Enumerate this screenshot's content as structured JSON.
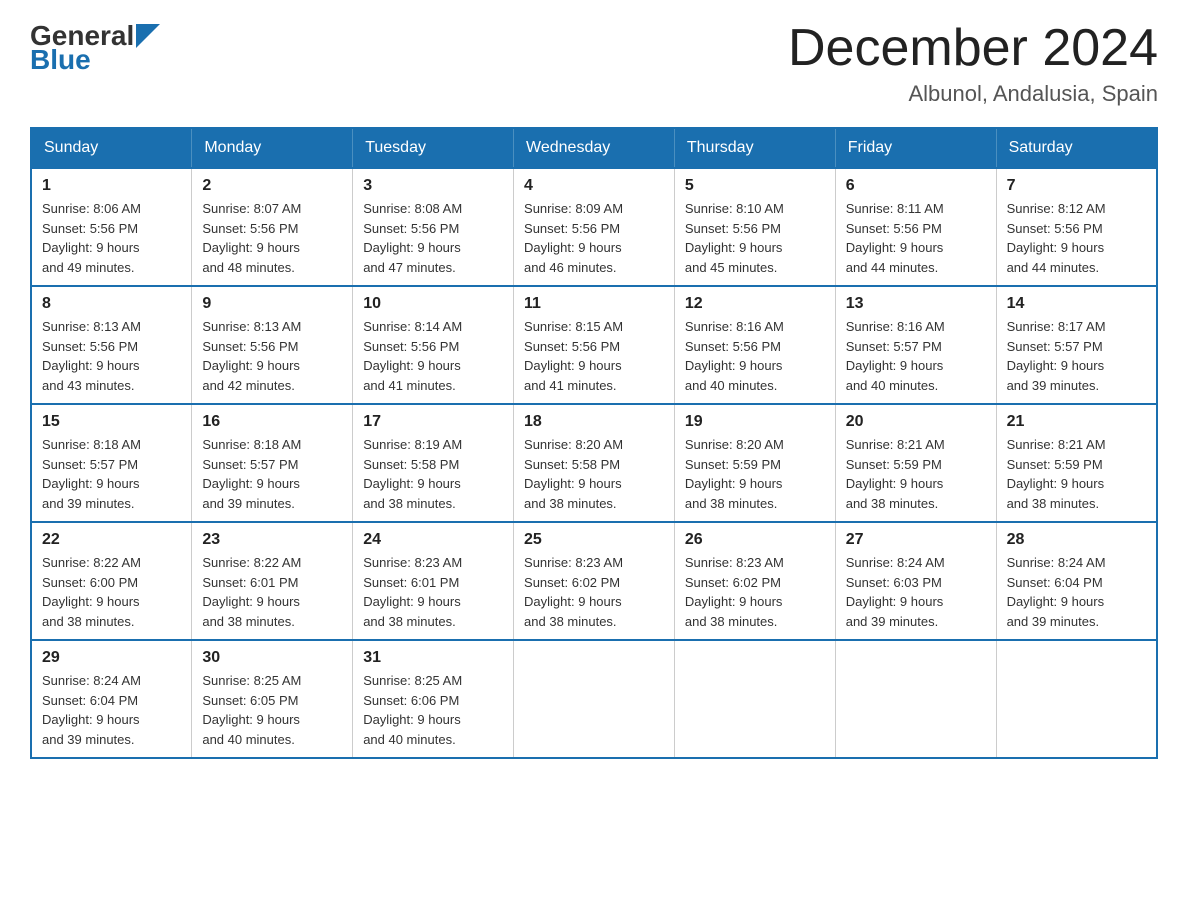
{
  "header": {
    "logo_general": "General",
    "logo_blue": "Blue",
    "month_year": "December 2024",
    "location": "Albunol, Andalusia, Spain"
  },
  "weekdays": [
    "Sunday",
    "Monday",
    "Tuesday",
    "Wednesday",
    "Thursday",
    "Friday",
    "Saturday"
  ],
  "weeks": [
    [
      {
        "day": "1",
        "sunrise": "8:06 AM",
        "sunset": "5:56 PM",
        "daylight": "9 hours and 49 minutes."
      },
      {
        "day": "2",
        "sunrise": "8:07 AM",
        "sunset": "5:56 PM",
        "daylight": "9 hours and 48 minutes."
      },
      {
        "day": "3",
        "sunrise": "8:08 AM",
        "sunset": "5:56 PM",
        "daylight": "9 hours and 47 minutes."
      },
      {
        "day": "4",
        "sunrise": "8:09 AM",
        "sunset": "5:56 PM",
        "daylight": "9 hours and 46 minutes."
      },
      {
        "day": "5",
        "sunrise": "8:10 AM",
        "sunset": "5:56 PM",
        "daylight": "9 hours and 45 minutes."
      },
      {
        "day": "6",
        "sunrise": "8:11 AM",
        "sunset": "5:56 PM",
        "daylight": "9 hours and 44 minutes."
      },
      {
        "day": "7",
        "sunrise": "8:12 AM",
        "sunset": "5:56 PM",
        "daylight": "9 hours and 44 minutes."
      }
    ],
    [
      {
        "day": "8",
        "sunrise": "8:13 AM",
        "sunset": "5:56 PM",
        "daylight": "9 hours and 43 minutes."
      },
      {
        "day": "9",
        "sunrise": "8:13 AM",
        "sunset": "5:56 PM",
        "daylight": "9 hours and 42 minutes."
      },
      {
        "day": "10",
        "sunrise": "8:14 AM",
        "sunset": "5:56 PM",
        "daylight": "9 hours and 41 minutes."
      },
      {
        "day": "11",
        "sunrise": "8:15 AM",
        "sunset": "5:56 PM",
        "daylight": "9 hours and 41 minutes."
      },
      {
        "day": "12",
        "sunrise": "8:16 AM",
        "sunset": "5:56 PM",
        "daylight": "9 hours and 40 minutes."
      },
      {
        "day": "13",
        "sunrise": "8:16 AM",
        "sunset": "5:57 PM",
        "daylight": "9 hours and 40 minutes."
      },
      {
        "day": "14",
        "sunrise": "8:17 AM",
        "sunset": "5:57 PM",
        "daylight": "9 hours and 39 minutes."
      }
    ],
    [
      {
        "day": "15",
        "sunrise": "8:18 AM",
        "sunset": "5:57 PM",
        "daylight": "9 hours and 39 minutes."
      },
      {
        "day": "16",
        "sunrise": "8:18 AM",
        "sunset": "5:57 PM",
        "daylight": "9 hours and 39 minutes."
      },
      {
        "day": "17",
        "sunrise": "8:19 AM",
        "sunset": "5:58 PM",
        "daylight": "9 hours and 38 minutes."
      },
      {
        "day": "18",
        "sunrise": "8:20 AM",
        "sunset": "5:58 PM",
        "daylight": "9 hours and 38 minutes."
      },
      {
        "day": "19",
        "sunrise": "8:20 AM",
        "sunset": "5:59 PM",
        "daylight": "9 hours and 38 minutes."
      },
      {
        "day": "20",
        "sunrise": "8:21 AM",
        "sunset": "5:59 PM",
        "daylight": "9 hours and 38 minutes."
      },
      {
        "day": "21",
        "sunrise": "8:21 AM",
        "sunset": "5:59 PM",
        "daylight": "9 hours and 38 minutes."
      }
    ],
    [
      {
        "day": "22",
        "sunrise": "8:22 AM",
        "sunset": "6:00 PM",
        "daylight": "9 hours and 38 minutes."
      },
      {
        "day": "23",
        "sunrise": "8:22 AM",
        "sunset": "6:01 PM",
        "daylight": "9 hours and 38 minutes."
      },
      {
        "day": "24",
        "sunrise": "8:23 AM",
        "sunset": "6:01 PM",
        "daylight": "9 hours and 38 minutes."
      },
      {
        "day": "25",
        "sunrise": "8:23 AM",
        "sunset": "6:02 PM",
        "daylight": "9 hours and 38 minutes."
      },
      {
        "day": "26",
        "sunrise": "8:23 AM",
        "sunset": "6:02 PM",
        "daylight": "9 hours and 38 minutes."
      },
      {
        "day": "27",
        "sunrise": "8:24 AM",
        "sunset": "6:03 PM",
        "daylight": "9 hours and 39 minutes."
      },
      {
        "day": "28",
        "sunrise": "8:24 AM",
        "sunset": "6:04 PM",
        "daylight": "9 hours and 39 minutes."
      }
    ],
    [
      {
        "day": "29",
        "sunrise": "8:24 AM",
        "sunset": "6:04 PM",
        "daylight": "9 hours and 39 minutes."
      },
      {
        "day": "30",
        "sunrise": "8:25 AM",
        "sunset": "6:05 PM",
        "daylight": "9 hours and 40 minutes."
      },
      {
        "day": "31",
        "sunrise": "8:25 AM",
        "sunset": "6:06 PM",
        "daylight": "9 hours and 40 minutes."
      },
      null,
      null,
      null,
      null
    ]
  ],
  "labels": {
    "sunrise_prefix": "Sunrise: ",
    "sunset_prefix": "Sunset: ",
    "daylight_prefix": "Daylight: "
  }
}
